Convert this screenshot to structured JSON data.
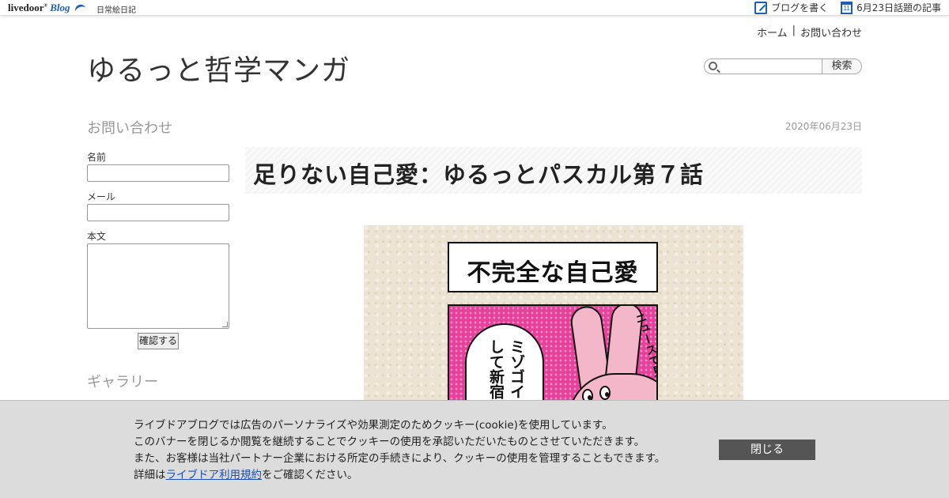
{
  "topbar": {
    "logo_text": "livedoor",
    "logo_blog": "Blog",
    "blog_name": "日常絵日記",
    "write_label": "ブログを書く",
    "topics_label": "6月23日話題の記事",
    "calendar_day": "11"
  },
  "header": {
    "home_link": "ホーム",
    "separator": "|",
    "contact_link": "お問い合わせ",
    "site_title": "ゆるっと哲学マンガ",
    "search_placeholder": "",
    "search_button": "検索"
  },
  "sidebar": {
    "contact_heading": "お問い合わせ",
    "name_label": "名前",
    "email_label": "メール",
    "body_label": "本文",
    "confirm_button": "確認する",
    "gallery_heading": "ギャラリー"
  },
  "article": {
    "date": "2020年06月23日",
    "title": "足りない自己愛：ゆるっとパスカル第７話",
    "manga": {
      "panel_title": "不完全な自己愛",
      "speech_text": "ミゾゴイくん　どうして新宿に来たの",
      "side_text": "ニュースで見たよ"
    }
  },
  "cookie_banner": {
    "line1": "ライブドアブログでは広告のパーソナライズや効果測定のためクッキー(cookie)を使用しています。",
    "line2": "このバナーを閉じるか閲覧を継続することでクッキーの使用を承認いただいたものとさせていただきます。",
    "line3": "また、お客様は当社パートナー企業における所定の手続きにより、クッキーの使用を管理することもできます。",
    "line4_prefix": "詳細は",
    "terms_link": "ライブドア利用規約",
    "line4_suffix": "をご確認ください。",
    "close_button": "閉じる"
  },
  "colors": {
    "brand_blue": "#1a5fb4",
    "manga_pink": "#e5409a",
    "banner_bg": "#dcdcdc"
  },
  "icons": [
    "pencil-edit-icon",
    "calendar-icon",
    "search-icon",
    "wing-icon"
  ]
}
